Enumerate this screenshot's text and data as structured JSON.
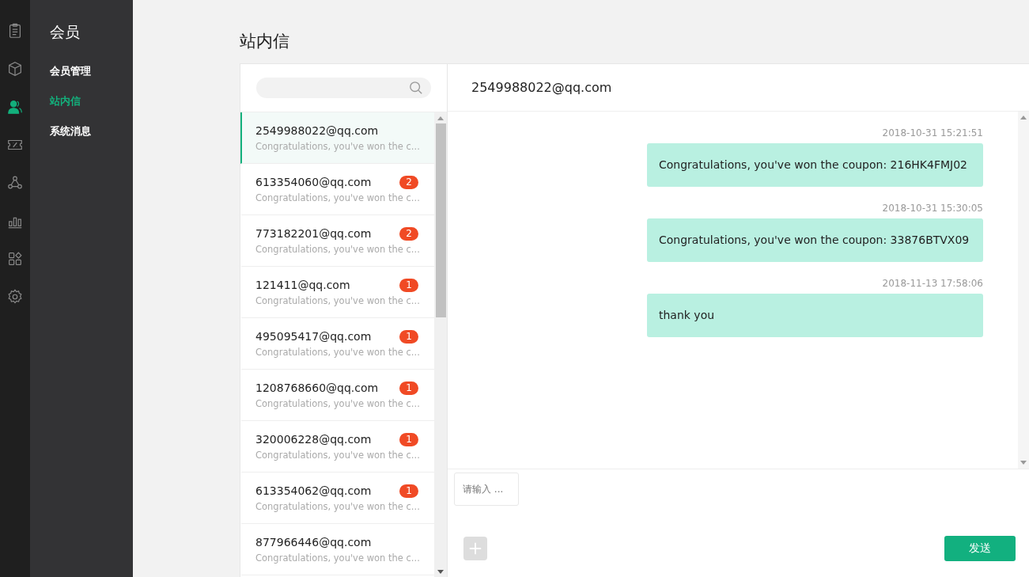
{
  "rail": [
    {
      "selected": false
    },
    {
      "selected": false
    },
    {
      "selected": true
    },
    {
      "selected": false
    },
    {
      "selected": false
    },
    {
      "selected": false
    },
    {
      "selected": false
    },
    {
      "selected": false
    }
  ],
  "sidebar": {
    "title": "会员",
    "items": [
      {
        "label": "会员管理",
        "selected": false
      },
      {
        "label": "站内信",
        "selected": true
      },
      {
        "label": "系统消息",
        "selected": false
      }
    ]
  },
  "page_title": "站内信",
  "conversations": [
    {
      "email": "2549988022@qq.com",
      "preview": "Congratulations, you've won the c...",
      "selected": true
    },
    {
      "email": "613354060@qq.com",
      "preview": "Congratulations, you've won the c...",
      "badge": "2",
      "selected": false
    },
    {
      "email": "773182201@qq.com",
      "preview": "Congratulations, you've won the c...",
      "badge": "2",
      "selected": false
    },
    {
      "email": "121411@qq.com",
      "preview": "Congratulations, you've won the c...",
      "badge": "1",
      "selected": false
    },
    {
      "email": "495095417@qq.com",
      "preview": "Congratulations, you've won the c...",
      "badge": "1",
      "selected": false
    },
    {
      "email": "1208768660@qq.com",
      "preview": "Congratulations, you've won the c...",
      "badge": "1",
      "selected": false
    },
    {
      "email": "320006228@qq.com",
      "preview": "Congratulations, you've won the c...",
      "badge": "1",
      "selected": false
    },
    {
      "email": "613354062@qq.com",
      "preview": "Congratulations, you've won the c...",
      "badge": "1",
      "selected": false
    },
    {
      "email": "877966446@qq.com",
      "preview": "Congratulations, you've won the c...",
      "selected": false
    }
  ],
  "chat": {
    "header": "2549988022@qq.com",
    "messages": [
      {
        "time": "2018-10-31 15:21:51",
        "text": "Congratulations, you've won the coupon: 216HK4FMJ02"
      },
      {
        "time": "2018-10-31 15:30:05",
        "text": "Congratulations, you've won the coupon: 33876BTVX09"
      },
      {
        "time": "2018-11-13 17:58:06",
        "text": "thank you"
      }
    ],
    "input_placeholder": "请输入 ...",
    "send_button": "发送"
  }
}
